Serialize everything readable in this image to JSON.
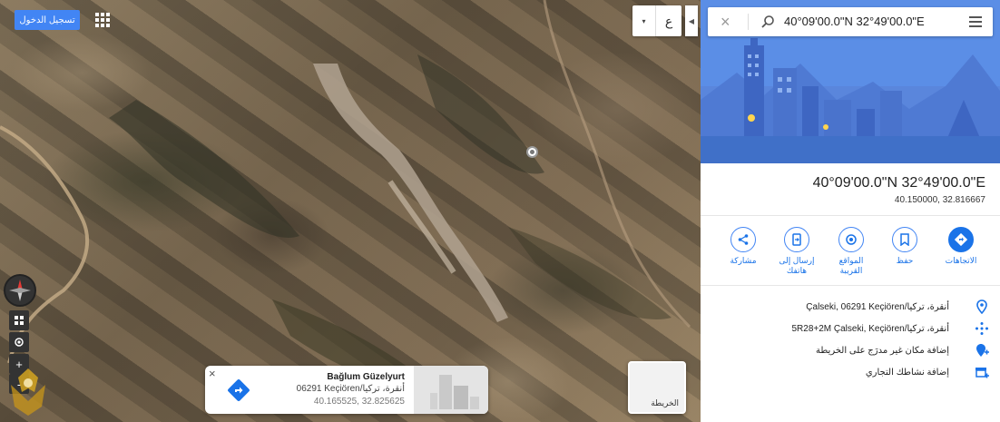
{
  "map": {
    "signin_label": "تسجيل الدخول",
    "language_label": "ع",
    "language_arrow": "▾",
    "collapse_arrow": "◀",
    "zoom_in": "+",
    "zoom_out": "-",
    "info_card": {
      "close": "×",
      "title": "Bağlum Güzelyurt",
      "address": "06291 Keçiören/أنقرة، تركيا",
      "coords": "40.165525, 32.825625"
    },
    "layer_label": "الخريطة"
  },
  "panel": {
    "search_close": "×",
    "search_query": "40°09'00.0\"N 32°49'00.0\"E",
    "title": "40°09'00.0\"N 32°49'00.0\"E",
    "decimal_coords": "40.150000, 32.816667",
    "actions": [
      {
        "label": "الاتجاهات",
        "icon": "directions-icon"
      },
      {
        "label": "حفظ",
        "icon": "bookmark-icon"
      },
      {
        "label": "المواقع القريبة",
        "icon": "nearby-icon"
      },
      {
        "label": "إرسال إلى هاتفك",
        "icon": "send-to-phone-icon"
      },
      {
        "label": "مشاركة",
        "icon": "share-icon"
      }
    ],
    "rows": [
      {
        "text": "Çalseki, 06291 Keçiören/أنقرة، تركيا",
        "icon": "location-pin-icon"
      },
      {
        "text": "5R28+2M Çalseki, Keçiören/أنقرة، تركيا",
        "icon": "plus-code-icon"
      },
      {
        "text": "إضافة مكان غير مدرَج على الخريطة",
        "icon": "add-place-icon"
      },
      {
        "text": "إضافة نشاطك التجاري",
        "icon": "add-business-icon"
      }
    ]
  },
  "colors": {
    "accent": "#1a73e8",
    "signin": "#4285f4",
    "hero_sky": "#5b8ee6"
  }
}
